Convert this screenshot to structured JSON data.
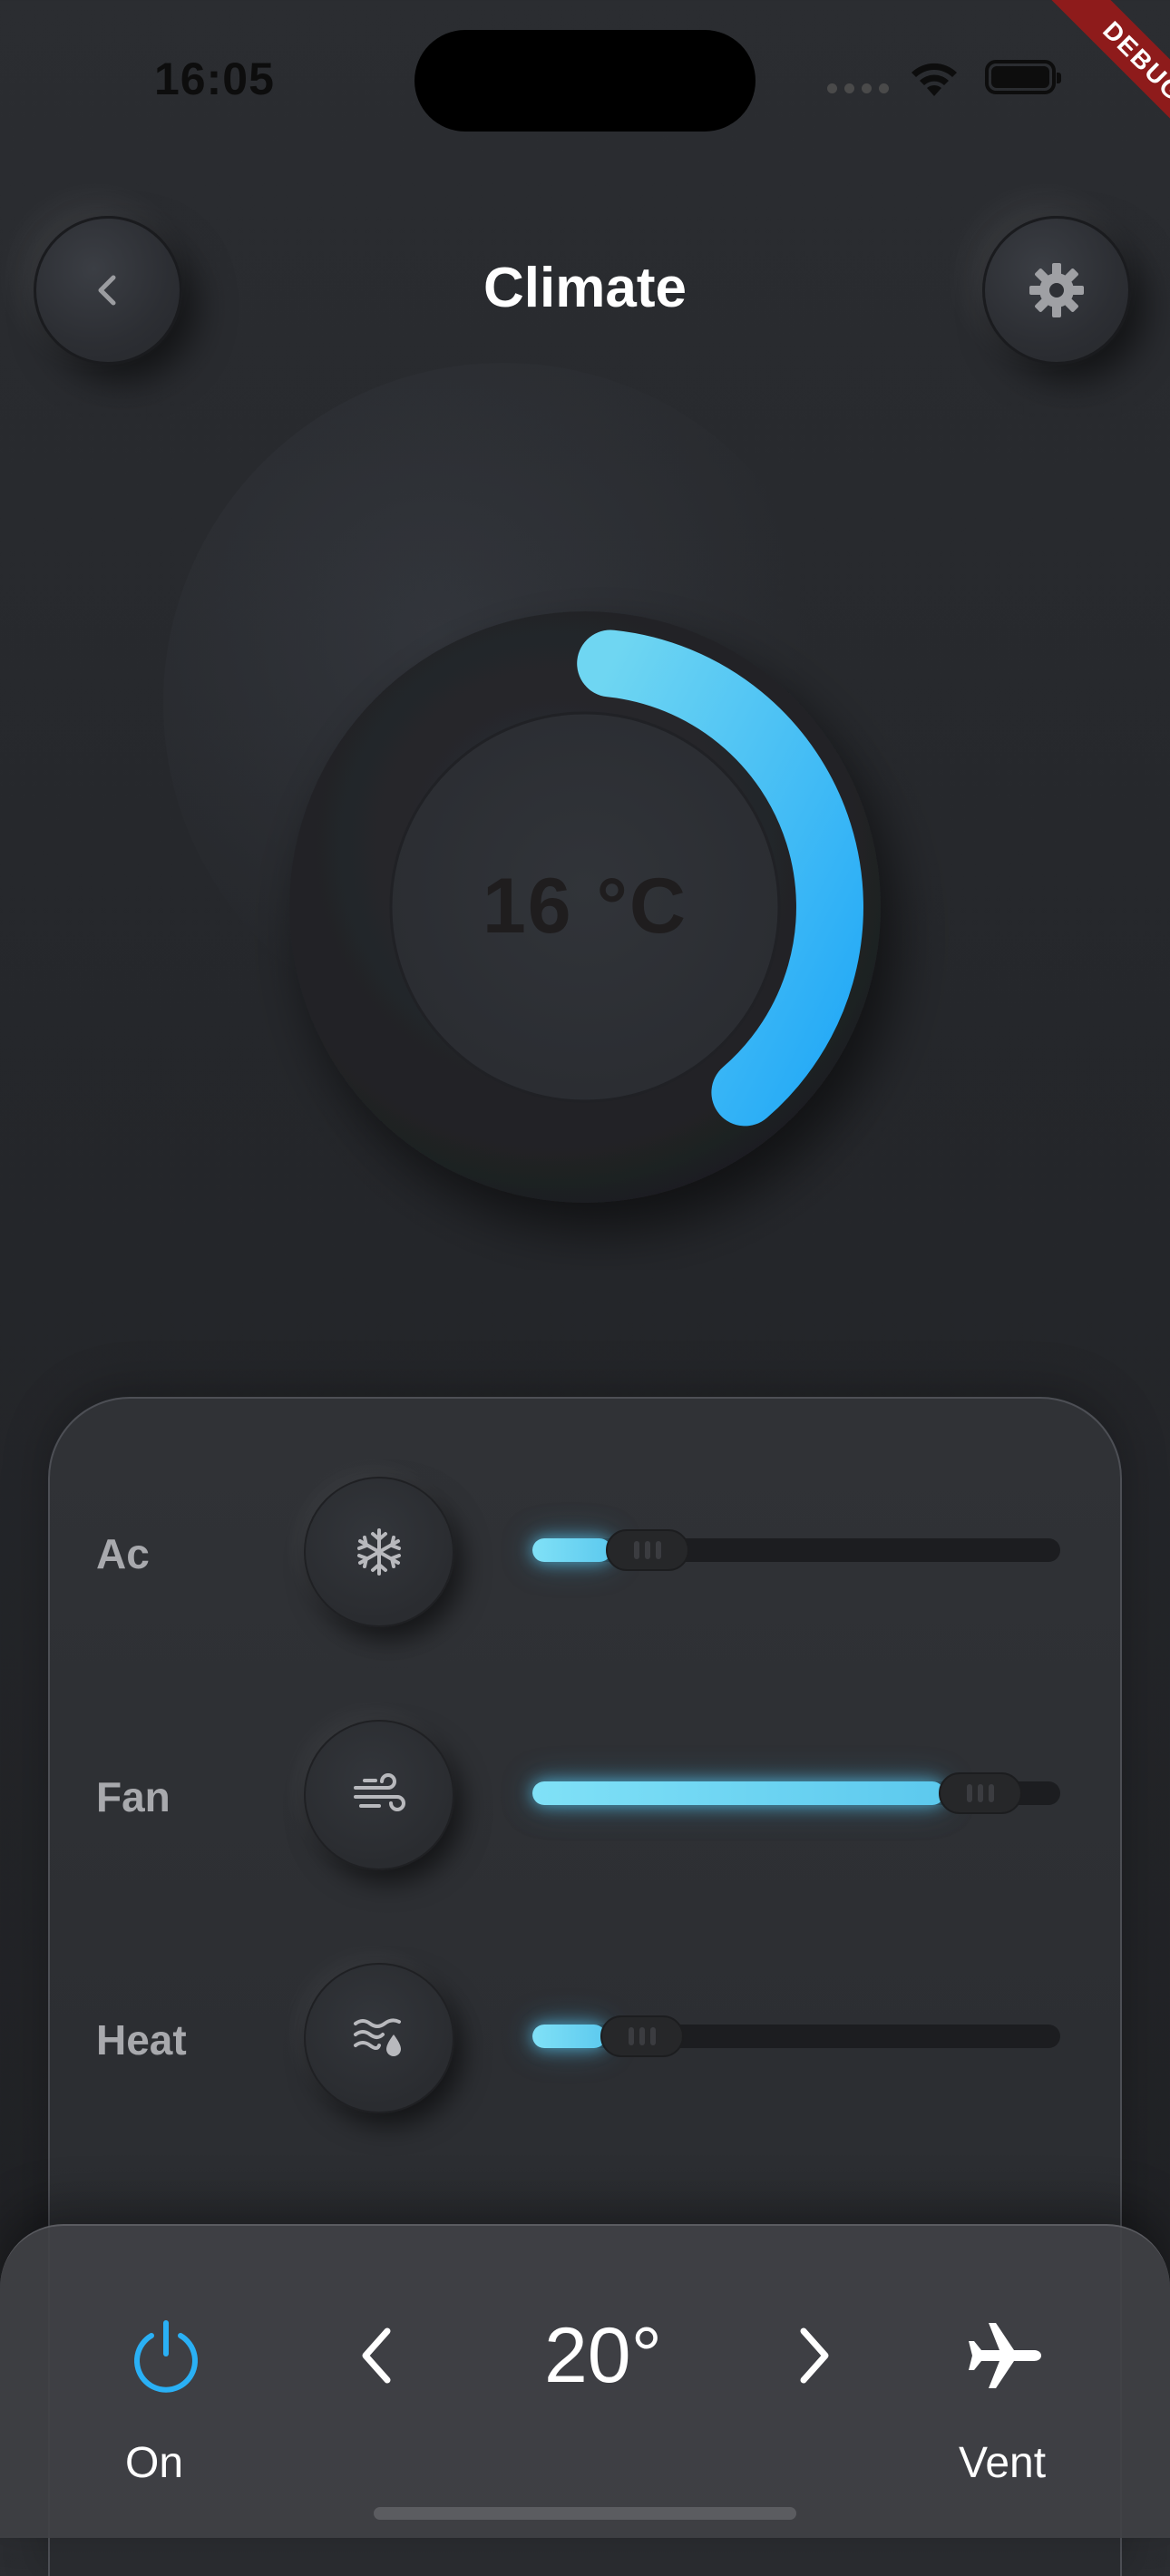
{
  "status_bar": {
    "time": "16:05",
    "debug_label": "DEBUG"
  },
  "header": {
    "title": "Climate",
    "back_icon": "chevron-left-icon",
    "settings_icon": "gear-icon"
  },
  "dial": {
    "value_label": "16 °C",
    "temperature": 16,
    "progress_fraction": 0.37,
    "arc_color": "#2ab0f5"
  },
  "controls": [
    {
      "label": "Ac",
      "icon": "snowflake-icon",
      "level": 0.15
    },
    {
      "label": "Fan",
      "icon": "wind-icon",
      "level": 0.78
    },
    {
      "label": "Heat",
      "icon": "heat-waves-icon",
      "level": 0.14
    }
  ],
  "bottom_bar": {
    "power_label": "On",
    "temperature": "20°",
    "vent_label": "Vent",
    "power_color": "#2ab0f5"
  }
}
